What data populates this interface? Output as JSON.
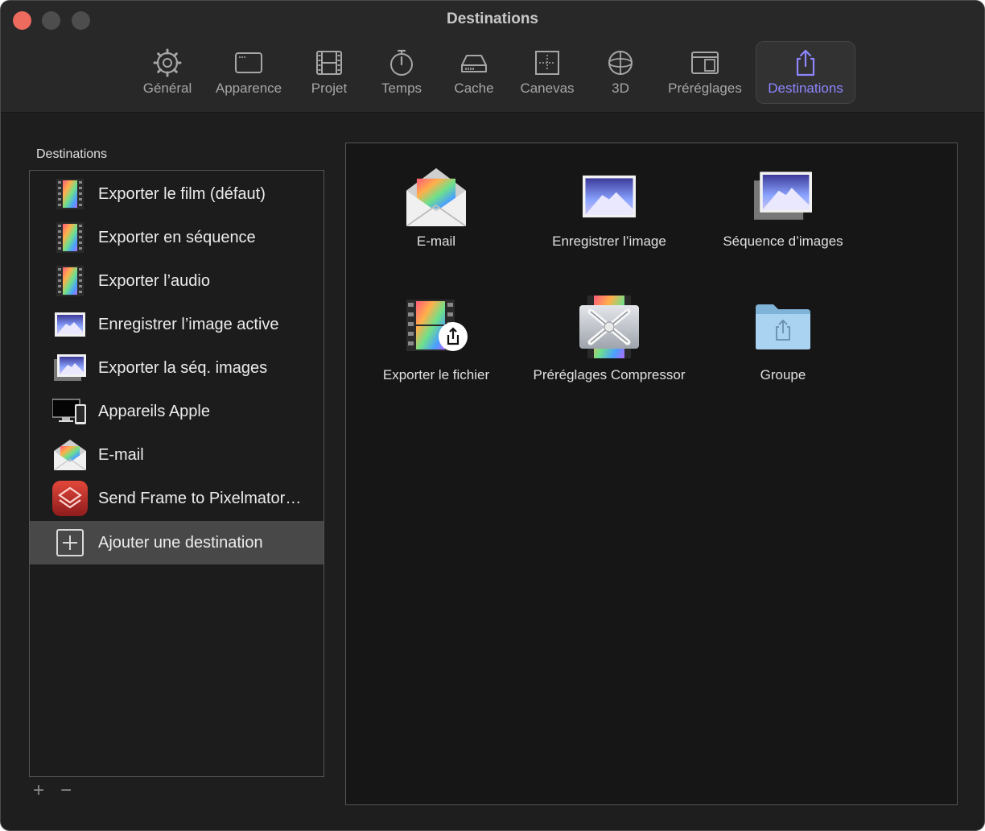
{
  "window": {
    "title": "Destinations"
  },
  "toolbar": {
    "items": [
      {
        "label": "Général",
        "icon": "gear-icon"
      },
      {
        "label": "Apparence",
        "icon": "window-icon"
      },
      {
        "label": "Projet",
        "icon": "film-icon"
      },
      {
        "label": "Temps",
        "icon": "stopwatch-icon"
      },
      {
        "label": "Cache",
        "icon": "drive-icon"
      },
      {
        "label": "Canevas",
        "icon": "canvas-icon"
      },
      {
        "label": "3D",
        "icon": "sphere-icon"
      },
      {
        "label": "Préréglages",
        "icon": "presets-icon"
      },
      {
        "label": "Destinations",
        "icon": "share-icon",
        "active": true
      }
    ],
    "active_color": "#8e86ff"
  },
  "sidebar": {
    "title": "Destinations",
    "items": [
      {
        "label": "Exporter le film (défaut)",
        "icon": "film-strip-icon"
      },
      {
        "label": "Exporter en séquence",
        "icon": "film-strip-icon"
      },
      {
        "label": "Exporter l’audio",
        "icon": "film-strip-icon"
      },
      {
        "label": "Enregistrer l’image active",
        "icon": "mountain-image-icon"
      },
      {
        "label": "Exporter la séq. images",
        "icon": "image-stack-icon"
      },
      {
        "label": "Appareils Apple",
        "icon": "apple-devices-icon"
      },
      {
        "label": "E-mail",
        "icon": "envelope-icon"
      },
      {
        "label": "Send Frame to Pixelmator…",
        "icon": "pixelmator-icon"
      },
      {
        "label": "Ajouter une destination",
        "icon": "plus-square-icon",
        "selected": true
      }
    ],
    "add_label": "+",
    "remove_label": "−"
  },
  "grid": {
    "tiles": [
      {
        "label": "E-mail",
        "icon": "envelope-icon"
      },
      {
        "label": "Enregistrer l’image",
        "icon": "mountain-image-icon"
      },
      {
        "label": "Séquence d’images",
        "icon": "image-stack-icon"
      },
      {
        "label": "Exporter le fichier",
        "icon": "film-share-icon"
      },
      {
        "label": "Préréglages Compressor",
        "icon": "compressor-icon"
      },
      {
        "label": "Groupe",
        "icon": "folder-share-icon"
      }
    ]
  }
}
